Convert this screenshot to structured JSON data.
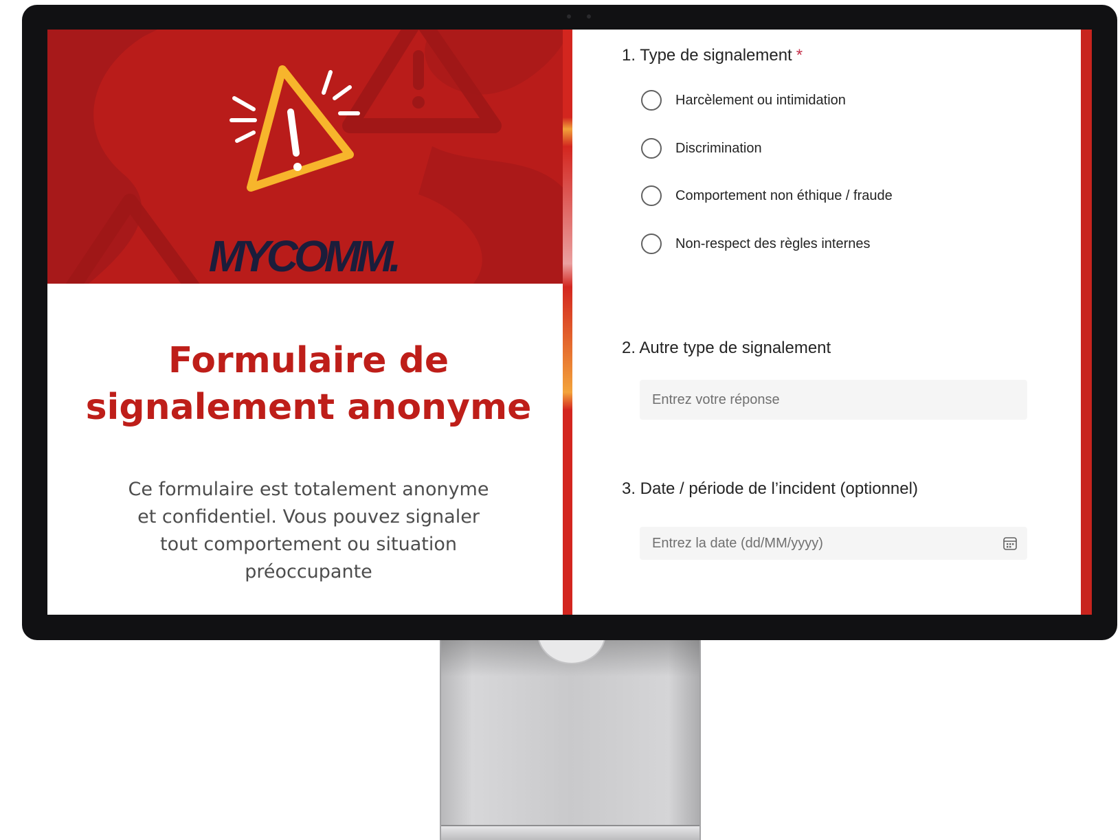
{
  "brand": {
    "logo_text": "MYCOMM."
  },
  "intro": {
    "title": "Formulaire de signalement anonyme",
    "description": "Ce formulaire est totalement anonyme et confidentiel. Vous pouvez signaler tout comportement ou situation préoccupante"
  },
  "form": {
    "q1": {
      "label": "1. Type de signalement",
      "required_mark": "*",
      "options": [
        "Harcèlement ou intimidation",
        "Discrimination",
        "Comportement non éthique / fraude",
        "Non-respect des règles internes"
      ]
    },
    "q2": {
      "label": "2. Autre type de signalement",
      "placeholder": "Entrez votre réponse"
    },
    "q3": {
      "label": "3. Date / période de l’incident (optionnel)",
      "placeholder": "Entrez la date (dd/MM/yyyy)",
      "icon": "calendar-icon"
    }
  },
  "colors": {
    "brand_red": "#be1e19",
    "hero_red": "#b91c1a",
    "warning_yellow": "#f7b52c",
    "logo_navy": "#1b1d3b",
    "required_star": "#c4314b"
  }
}
